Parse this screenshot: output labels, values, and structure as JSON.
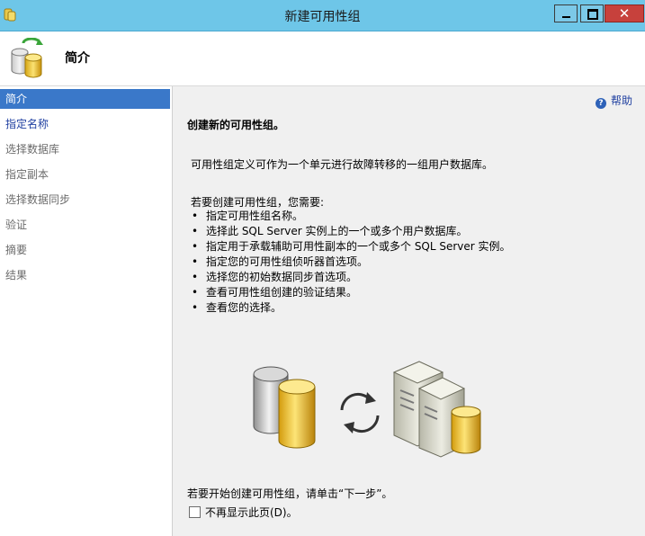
{
  "window": {
    "title": "新建可用性组",
    "close_glyph": "✕"
  },
  "header": {
    "title": "简介"
  },
  "sidebar": {
    "items": [
      {
        "label": "简介"
      },
      {
        "label": "指定名称"
      },
      {
        "label": "选择数据库"
      },
      {
        "label": "指定副本"
      },
      {
        "label": "选择数据同步"
      },
      {
        "label": "验证"
      },
      {
        "label": "摘要"
      },
      {
        "label": "结果"
      }
    ]
  },
  "main": {
    "help_label": "帮助",
    "heading": "创建新的可用性组。",
    "description": "可用性组定义可作为一个单元进行故障转移的一组用户数据库。",
    "lead": "若要创建可用性组，您需要:",
    "bullets": [
      "指定可用性组名称。",
      "选择此 SQL Server 实例上的一个或多个用户数据库。",
      "指定用于承载辅助可用性副本的一个或多个 SQL Server 实例。",
      "指定您的可用性组侦听器首选项。",
      "选择您的初始数据同步首选项。",
      "查看可用性组创建的验证结果。",
      "查看您的选择。"
    ],
    "footer": "若要开始创建可用性组，请单击“下一步”。",
    "checkbox_label": "不再显示此页(D)。",
    "checkbox_checked": false
  },
  "colors": {
    "titlebar": "#6ec6e8",
    "selected_nav": "#3a78c9",
    "close_button": "#c7413c"
  },
  "icons": [
    "app-icon",
    "database-wizard-icon",
    "help-icon",
    "database-icon",
    "sync-arrows-icon",
    "server-icon"
  ]
}
